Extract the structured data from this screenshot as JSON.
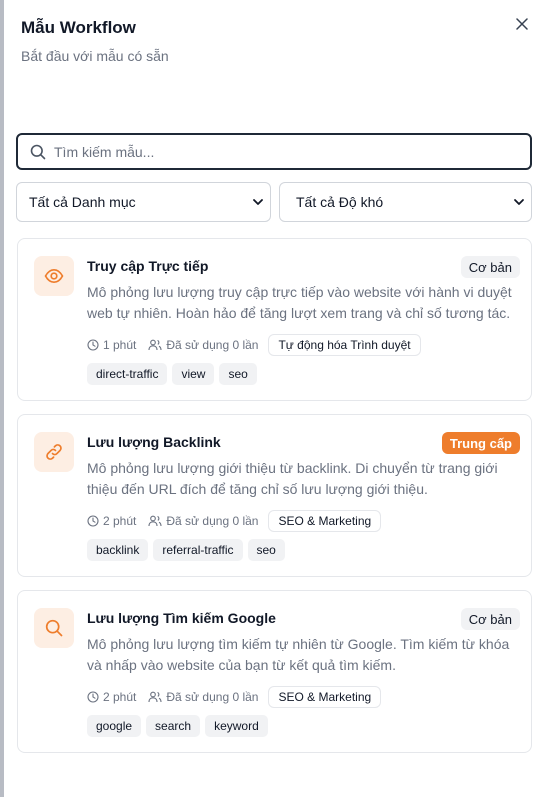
{
  "dialog": {
    "title": "Mẫu Workflow",
    "subtitle": "Bắt đầu với mẫu có sẵn"
  },
  "search": {
    "placeholder": "Tìm kiếm mẫu...",
    "value": ""
  },
  "filters": {
    "category": "Tất cả Danh mục",
    "difficulty": "Tất cả Độ khó"
  },
  "colors": {
    "accent": "#ee7d2c",
    "icon_bg": "#fdeee3"
  },
  "templates": [
    {
      "icon": "eye-icon",
      "title": "Truy cập Trực tiếp",
      "level": "Cơ bản",
      "description": "Mô phỏng lưu lượng truy cập trực tiếp vào website với hành vi duyệt web tự nhiên. Hoàn hảo để tăng lượt xem trang và chỉ số tương tác.",
      "duration": "1 phút",
      "usage": "Đã sử dụng 0 lần",
      "category": "Tự động hóa Trình duyệt",
      "tags": [
        "direct-traffic",
        "view",
        "seo"
      ]
    },
    {
      "icon": "link-icon",
      "title": "Lưu lượng Backlink",
      "level": "Trung cấp",
      "description": "Mô phỏng lưu lượng giới thiệu từ backlink. Di chuyển từ trang giới thiệu đến URL đích để tăng chỉ số lưu lượng giới thiệu.",
      "duration": "2 phút",
      "usage": "Đã sử dụng 0 lần",
      "category": "SEO & Marketing",
      "tags": [
        "backlink",
        "referral-traffic",
        "seo"
      ]
    },
    {
      "icon": "search-icon",
      "title": "Lưu lượng Tìm kiếm Google",
      "level": "Cơ bản",
      "description": "Mô phỏng lưu lượng tìm kiếm tự nhiên từ Google. Tìm kiếm từ khóa và nhấp vào website của bạn từ kết quả tìm kiếm.",
      "duration": "2 phút",
      "usage": "Đã sử dụng 0 lần",
      "category": "SEO & Marketing",
      "tags": [
        "google",
        "search",
        "keyword"
      ]
    }
  ]
}
